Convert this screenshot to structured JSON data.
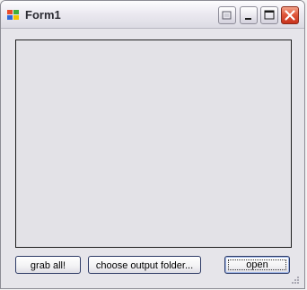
{
  "window": {
    "title": "Form1",
    "title_icon": "windows-form-icon",
    "controls": [
      "restore-down-icon",
      "minimize-icon",
      "maximize-icon",
      "close-icon"
    ]
  },
  "content": {
    "list_items": []
  },
  "buttons": {
    "grab_all": "grab all!",
    "choose_output_folder": "choose output folder...",
    "open": "open"
  },
  "colors": {
    "window_bg": "#e6e5ea",
    "close_button": "#d8442a"
  }
}
